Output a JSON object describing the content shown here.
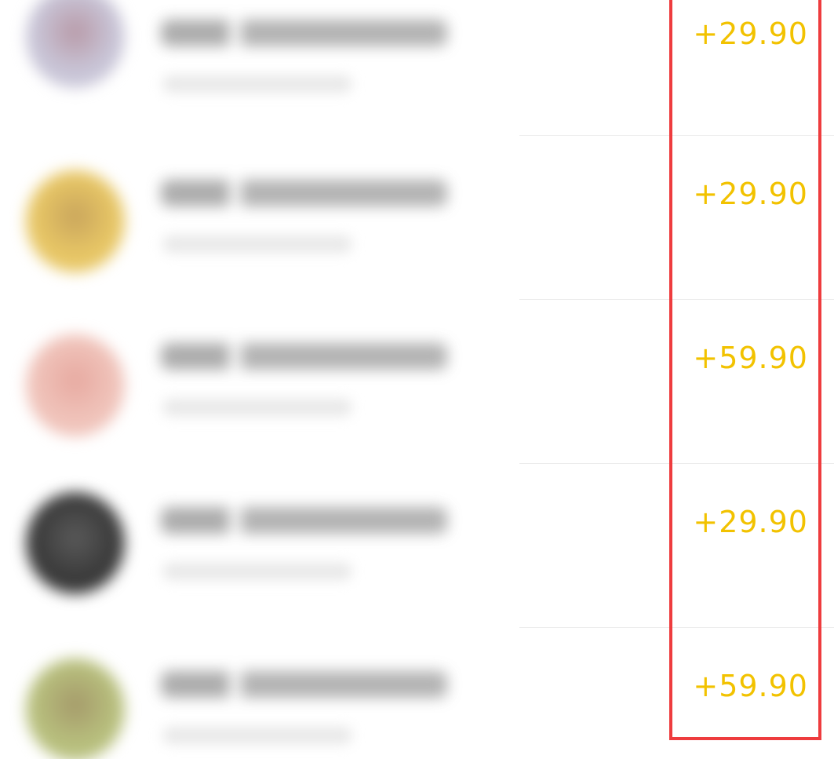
{
  "colors": {
    "amount": "#f2c200",
    "highlight": "#ee3c3e",
    "divider": "#ececec",
    "background": "#ffffff"
  },
  "transactions": [
    {
      "amount": "+29.90",
      "avatar_colors": [
        "#c9c6d8",
        "#b89aa8"
      ]
    },
    {
      "amount": "+29.90",
      "avatar_colors": [
        "#e8c766",
        "#c9a55c"
      ]
    },
    {
      "amount": "+59.90",
      "avatar_colors": [
        "#f0c4bb",
        "#e7a9a0"
      ]
    },
    {
      "amount": "+29.90",
      "avatar_colors": [
        "#3a3a3a",
        "#5a5a5a"
      ]
    },
    {
      "amount": "+59.90",
      "avatar_colors": [
        "#b8c07e",
        "#a59a6a"
      ]
    }
  ]
}
